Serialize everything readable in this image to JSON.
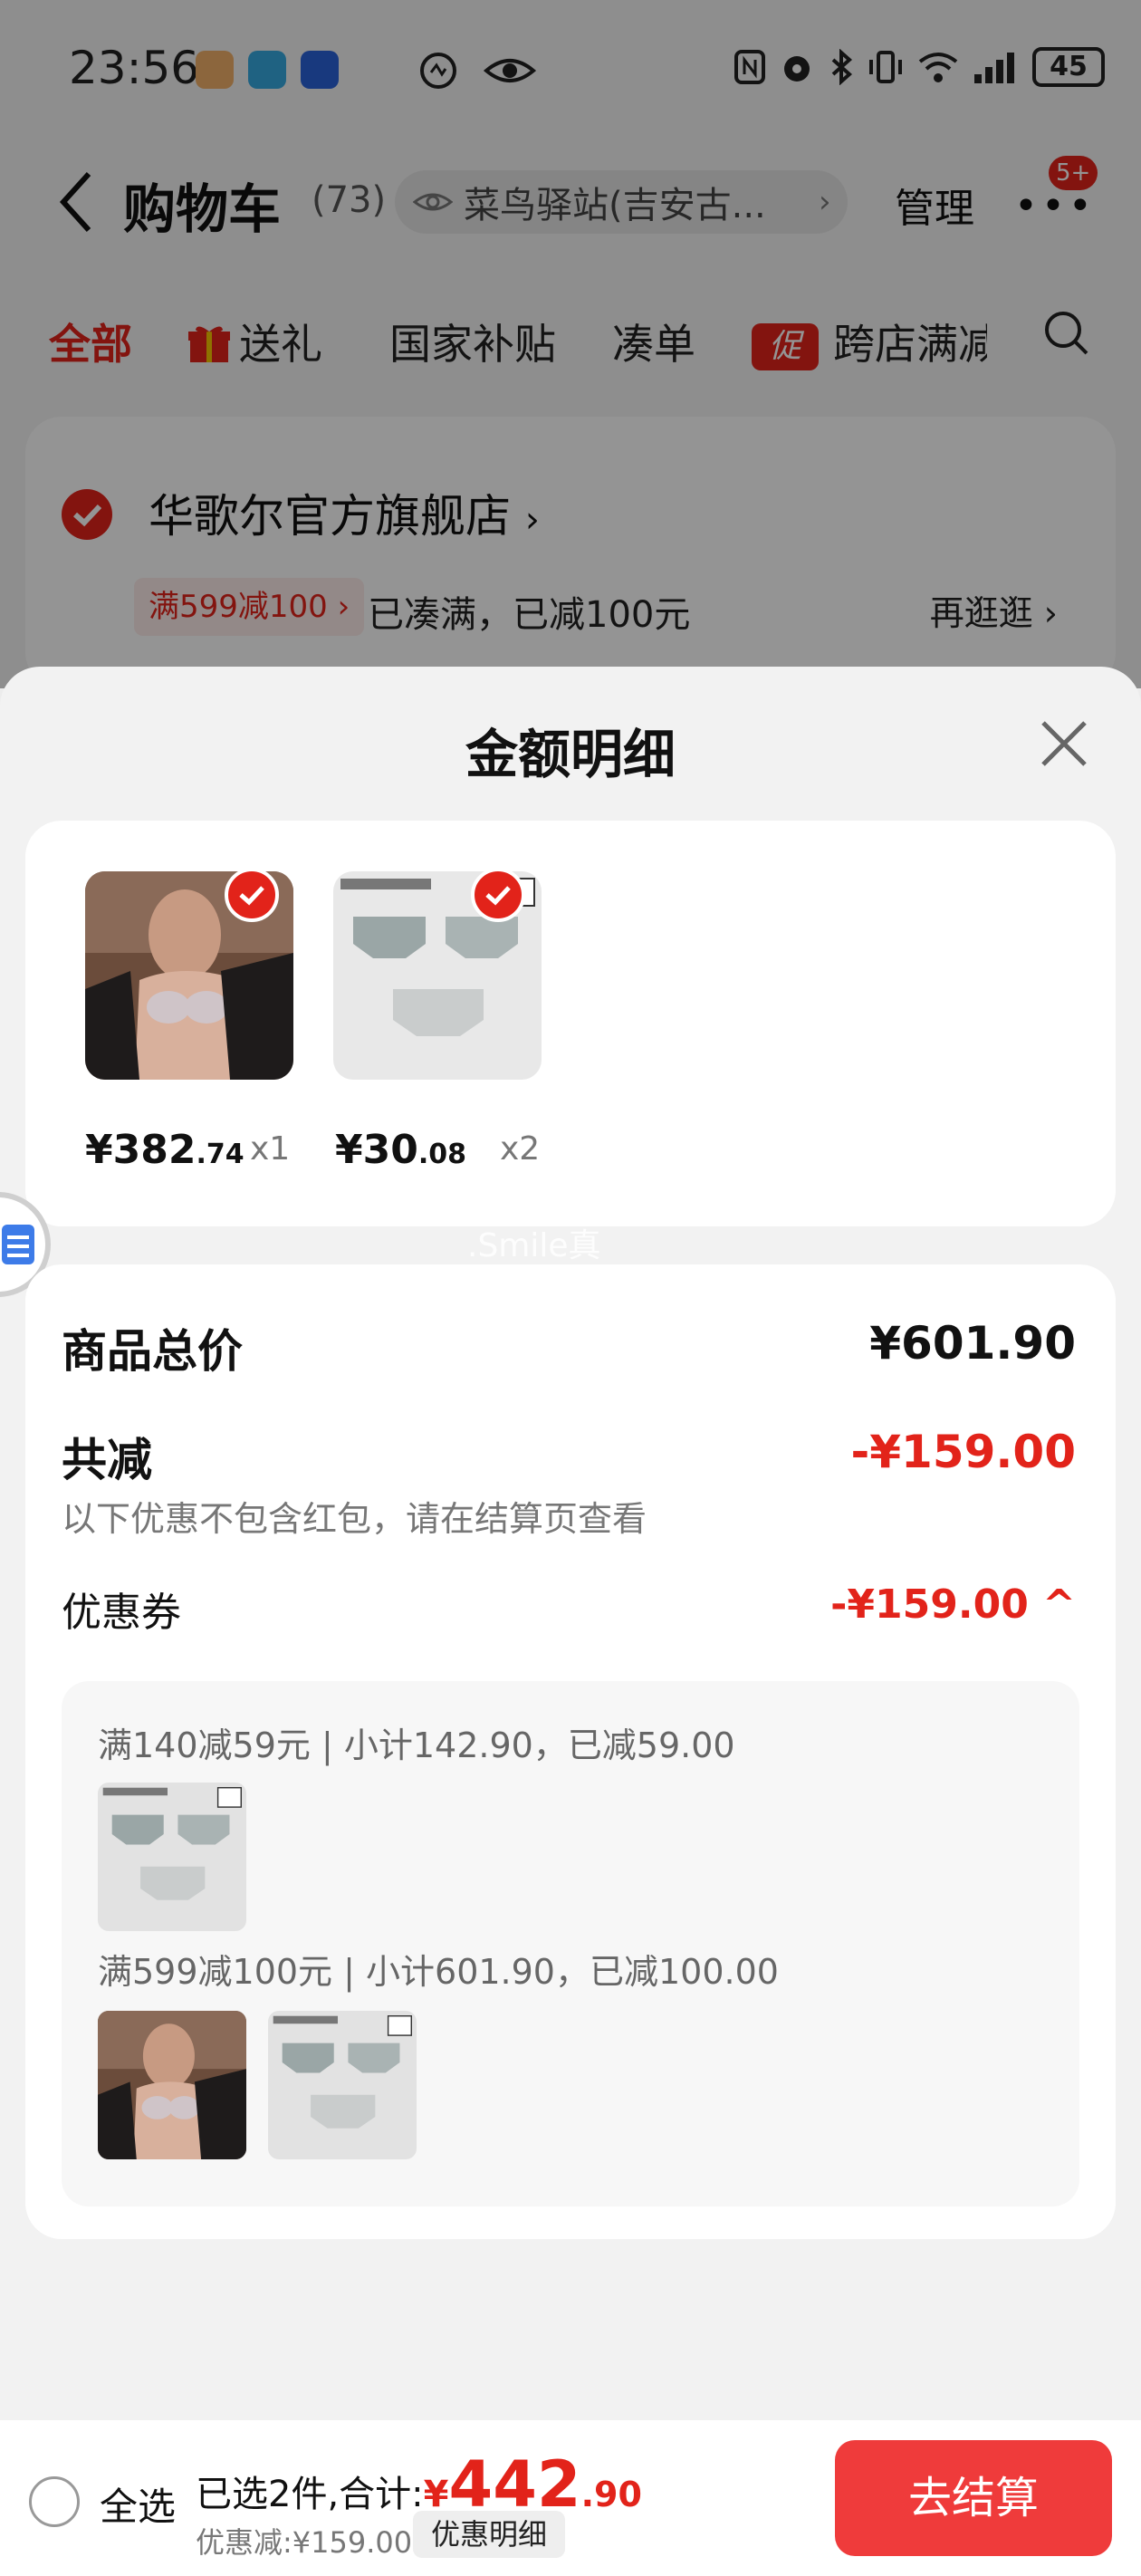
{
  "status_bar": {
    "time": "23:56",
    "battery": "45"
  },
  "nav": {
    "title": "购物车",
    "count": "(73)",
    "location": "菜鸟驿站(吉安古...",
    "manage": "管理",
    "more_badge": "5+"
  },
  "tabs": [
    {
      "label": "全部"
    },
    {
      "label": "送礼"
    },
    {
      "label": "国家补贴"
    },
    {
      "label": "凑单"
    },
    {
      "label": "跨店满减"
    }
  ],
  "promo_tag": "促",
  "store": {
    "name": "华歌尔官方旗舰店",
    "name_chevron": "›",
    "promo": "满599减100 ›",
    "promo_status": "已凑满，已减100元",
    "shop_more": "再逛逛 ›"
  },
  "sheet": {
    "title": "金额明细",
    "products": [
      {
        "price_int": "¥382",
        "price_dec": ".74",
        "qty": "x1"
      },
      {
        "price_int": "¥30",
        "price_dec": ".08",
        "qty": "x2"
      }
    ],
    "watermark": ".Smile真",
    "total_label": "商品总价",
    "total_value": "¥601.90",
    "discount_label": "共减",
    "discount_value": "-¥159.00",
    "discount_note": "以下优惠不包含红包，请在结算页查看",
    "coupon_label": "优惠券",
    "coupon_value": "-¥159.00 ^",
    "coupon_rules": [
      {
        "text": "满140减59元 | 小计142.90，已减59.00"
      },
      {
        "text": "满599减100元 | 小计601.90，已减100.00"
      }
    ]
  },
  "bottom": {
    "select_all": "全选",
    "selected_prefix": "已选2件,合计:",
    "currency": "¥",
    "total_int": "442",
    "total_dec": ".90",
    "discount_text": "优惠减:¥159.00",
    "discount_detail": "优惠明细",
    "checkout": "去结算"
  },
  "colors": {
    "accent": "#e2231a",
    "checkout": "#ef3b3b"
  }
}
